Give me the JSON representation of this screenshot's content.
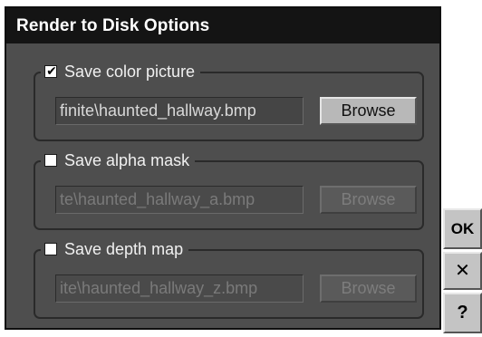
{
  "dialog": {
    "title": "Render to Disk Options"
  },
  "groups": [
    {
      "label": "Save color picture",
      "checked": true,
      "path": "finite\\haunted_hallway.bmp",
      "browse_label": "Browse",
      "enabled": true
    },
    {
      "label": "Save alpha mask",
      "checked": false,
      "path": "te\\haunted_hallway_a.bmp",
      "browse_label": "Browse",
      "enabled": false
    },
    {
      "label": "Save depth map",
      "checked": false,
      "path": "ite\\haunted_hallway_z.bmp",
      "browse_label": "Browse",
      "enabled": false
    }
  ],
  "side_buttons": {
    "ok_label": "OK",
    "close_glyph": "✕",
    "help_glyph": "?"
  },
  "check_glyph": "✔",
  "colors": {
    "dialog_bg": "#4e4e4e",
    "title_bg": "#141414",
    "button_face": "#c4c4c4"
  }
}
